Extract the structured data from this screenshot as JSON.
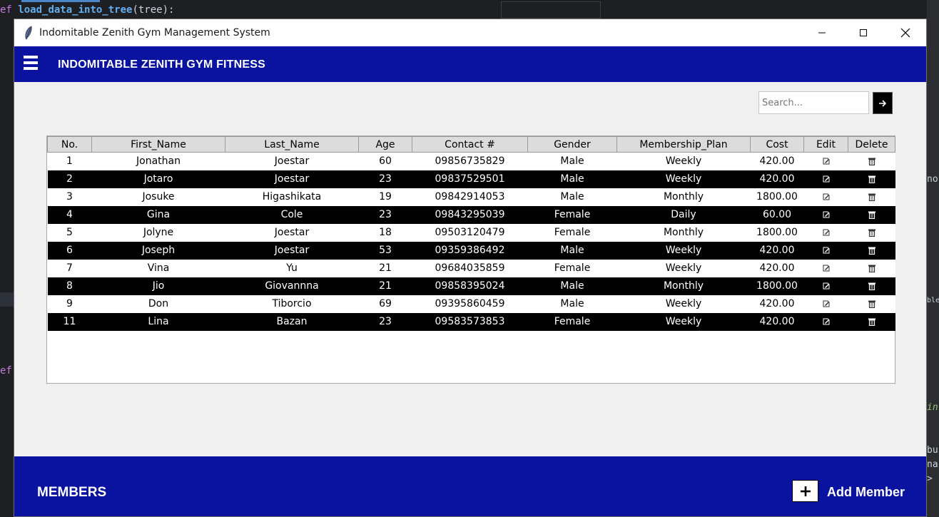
{
  "background": {
    "code_line_prefix": "ef ",
    "code_line_fn": "load_data_into_tree",
    "code_line_rest": "(tree):",
    "left_fragment": "ef",
    "right_fragments": [
      "no",
      "bles",
      "in",
      "bu",
      "na",
      ">"
    ]
  },
  "window": {
    "title": "Indomitable Zenith Gym Management System",
    "controls": {
      "minimize": "—",
      "maximize": "☐",
      "close": "✕"
    }
  },
  "header": {
    "brand": "INDOMITABLE ZENITH GYM FITNESS",
    "menu_icon": "hamburger-icon"
  },
  "search": {
    "placeholder": "Search...",
    "button_icon": "arrow-right-icon"
  },
  "table": {
    "columns": [
      "No.",
      "First_Name",
      "Last_Name",
      "Age",
      "Contact #",
      "Gender",
      "Membership_Plan",
      "Cost",
      "Edit",
      "Delete"
    ],
    "rows": [
      [
        "1",
        "Jonathan",
        "Joestar",
        "60",
        "09856735829",
        "Male",
        "Weekly",
        "420.00"
      ],
      [
        "2",
        "Jotaro",
        "Joestar",
        "23",
        "09837529501",
        "Male",
        "Weekly",
        "420.00"
      ],
      [
        "3",
        "Josuke",
        "Higashikata",
        "19",
        "09842914053",
        "Male",
        "Monthly",
        "1800.00"
      ],
      [
        "4",
        "Gina",
        "Cole",
        "23",
        "09843295039",
        "Female",
        "Daily",
        "60.00"
      ],
      [
        "5",
        "Jolyne",
        "Joestar",
        "18",
        "09503120479",
        "Female",
        "Monthly",
        "1800.00"
      ],
      [
        "6",
        "Joseph",
        "Joestar",
        "53",
        "09359386492",
        "Male",
        "Weekly",
        "420.00"
      ],
      [
        "7",
        "Vina",
        "Yu",
        "21",
        "09684035859",
        "Female",
        "Weekly",
        "420.00"
      ],
      [
        "8",
        "Jio",
        "Giovannna",
        "21",
        "09858395024",
        "Male",
        "Monthly",
        "1800.00"
      ],
      [
        "9",
        "Don",
        "Tiborcio",
        "69",
        "09395860459",
        "Male",
        "Weekly",
        "420.00"
      ],
      [
        "11",
        "Lina",
        "Bazan",
        "23",
        "09583573853",
        "Female",
        "Weekly",
        "420.00"
      ]
    ],
    "edit_icon": "edit-icon",
    "delete_icon": "trash-icon"
  },
  "footer": {
    "title": "MEMBERS",
    "add_label": "Add Member",
    "add_icon": "plus-icon"
  },
  "colors": {
    "brand_blue": "#0a12a0",
    "row_dark": "#000000",
    "row_light": "#ffffff"
  }
}
